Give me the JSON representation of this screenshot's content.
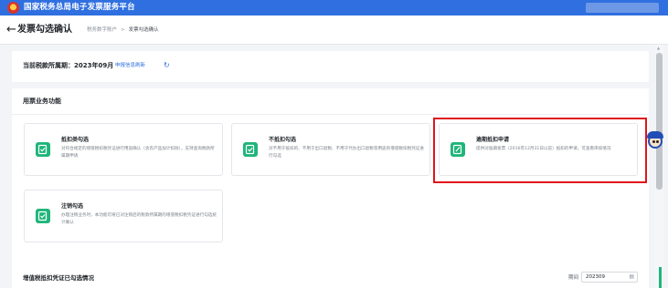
{
  "app": {
    "title": "国家税务总局电子发票服务平台"
  },
  "header": {
    "back_icon": "arrow-left-icon",
    "title": "发票勾选确认",
    "breadcrumb": [
      "税务数字账户",
      "发票勾选确认"
    ],
    "breadcrumb_sep": ">"
  },
  "period": {
    "label": "当前税款所属期：2023年09月",
    "link": "申报信息刷新",
    "refresh_icon": "refresh-icon"
  },
  "functions": {
    "section_title": "用票业务功能",
    "items": [
      {
        "title": "抵扣类勾选",
        "desc": "对符合规定的增值税扣税凭证进行用途确认（含农产品加计扣除），支持查询税款所属期申请"
      },
      {
        "title": "不抵扣勾选",
        "desc": "对不用于抵扣的、不用于出口退税、不用于代办出口退税等用途的增值税扣税凭证进行勾选"
      },
      {
        "title": "逾期抵扣申请",
        "desc": "提供对逾期发票（2016年12月31日以前）抵扣的申请，可查看审核情况"
      },
      {
        "title": "注销勾选",
        "desc": "办理注销业务时，本功能可将已对注销后的税款所属期的增值税扣税凭证进行勾选统计确认"
      }
    ]
  },
  "bottom": {
    "title": "增值税抵扣凭证已勾选情况",
    "date_label": "期间",
    "date_value": "202309"
  },
  "colors": {
    "primary": "#2f6fe0",
    "accent_green": "#1fb57a",
    "highlight_red": "#e1141b"
  }
}
